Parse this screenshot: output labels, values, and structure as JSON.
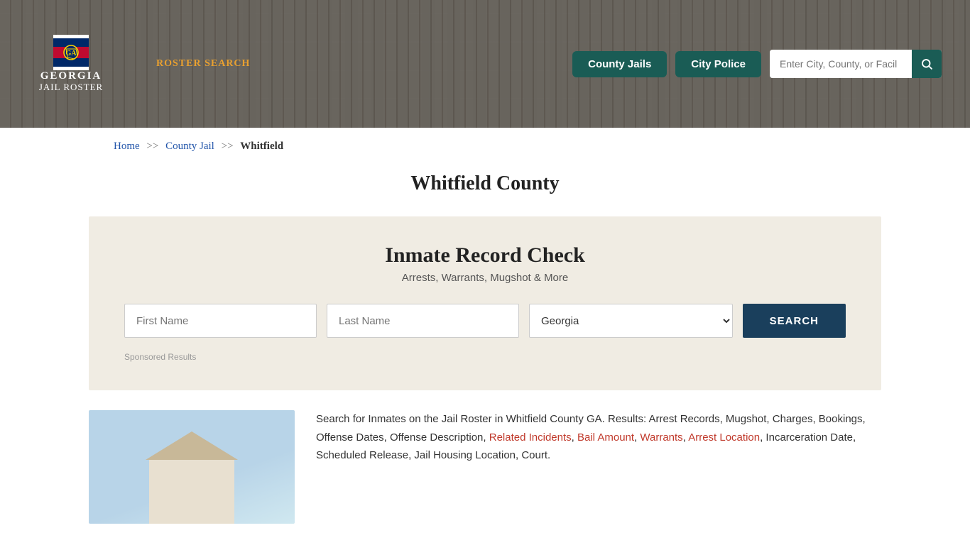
{
  "header": {
    "logo": {
      "georgia": "GEORGIA",
      "jail_roster": "JAIL ROSTER"
    },
    "nav": {
      "roster_search": "ROSTER SEARCH"
    },
    "buttons": {
      "county_jails": "County Jails",
      "city_police": "City Police"
    },
    "search": {
      "placeholder": "Enter City, County, or Facil"
    }
  },
  "breadcrumb": {
    "home": "Home",
    "sep1": ">>",
    "county_jail": "County Jail",
    "sep2": ">>",
    "current": "Whitfield"
  },
  "page_title": "Whitfield County",
  "inmate_record": {
    "title": "Inmate Record Check",
    "subtitle": "Arrests, Warrants, Mugshot & More",
    "first_name_placeholder": "First Name",
    "last_name_placeholder": "Last Name",
    "state_default": "Georgia",
    "search_button": "SEARCH",
    "sponsored": "Sponsored Results"
  },
  "bottom_text": "Search for Inmates on the Jail Roster in Whitfield County GA. Results: Arrest Records, Mugshot, Charges, Bookings, Offense Dates, Offense Description, Related Incidents, Bail Amount, Warrants, Arrest Location, Incarceration Date, Scheduled Release, Jail Housing Location, Court.",
  "bottom_text_highlights": [
    "Related Incidents",
    "Bail Amount",
    "Warrants",
    "Arrest Location"
  ]
}
